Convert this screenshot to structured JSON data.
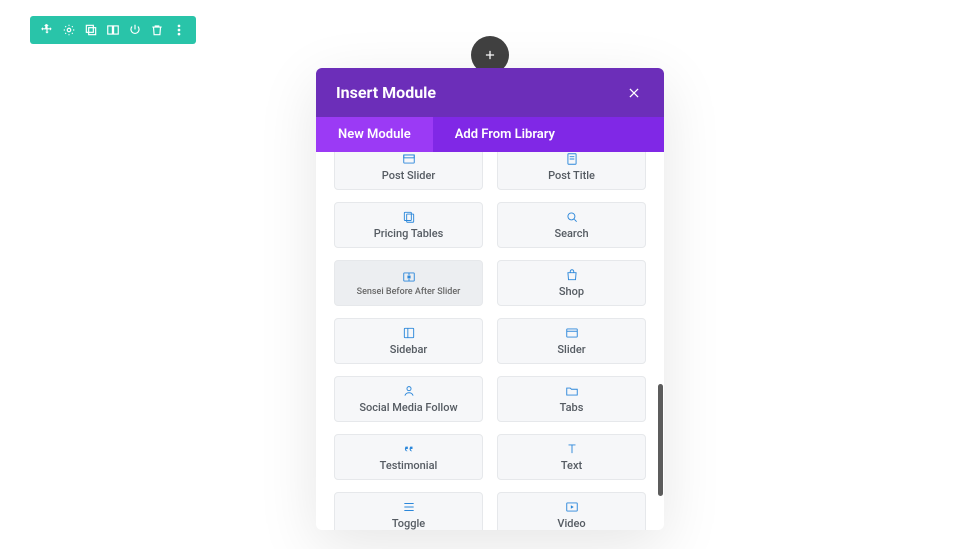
{
  "toolbar": {
    "items": [
      "move",
      "settings",
      "copy-row",
      "columns",
      "power",
      "delete",
      "more"
    ]
  },
  "modal": {
    "title": "Insert Module",
    "tabs": {
      "new_module": "New Module",
      "add_from_library": "Add From Library"
    },
    "modules": [
      {
        "id": "post-slider",
        "label": "Post Slider",
        "icon": "image-card"
      },
      {
        "id": "post-title",
        "label": "Post Title",
        "icon": "page"
      },
      {
        "id": "pricing-tables",
        "label": "Pricing Tables",
        "icon": "copy"
      },
      {
        "id": "search",
        "label": "Search",
        "icon": "search"
      },
      {
        "id": "sensei-before-after-slider",
        "label": "Sensei Before After Slider",
        "icon": "compare",
        "hover": true
      },
      {
        "id": "shop",
        "label": "Shop",
        "icon": "bag"
      },
      {
        "id": "sidebar",
        "label": "Sidebar",
        "icon": "panel"
      },
      {
        "id": "slider",
        "label": "Slider",
        "icon": "play-frame"
      },
      {
        "id": "social-media-follow",
        "label": "Social Media Follow",
        "icon": "person"
      },
      {
        "id": "tabs",
        "label": "Tabs",
        "icon": "folder"
      },
      {
        "id": "testimonial",
        "label": "Testimonial",
        "icon": "quote"
      },
      {
        "id": "text",
        "label": "Text",
        "icon": "text"
      },
      {
        "id": "toggle",
        "label": "Toggle",
        "icon": "rows"
      },
      {
        "id": "video",
        "label": "Video",
        "icon": "video"
      }
    ]
  }
}
